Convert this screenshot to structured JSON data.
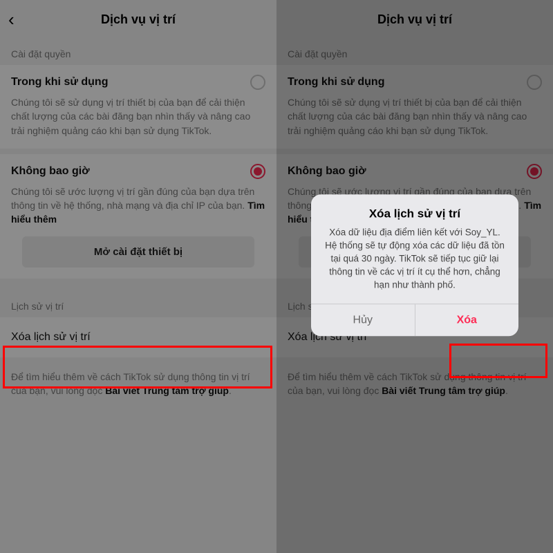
{
  "accent": "#fe2c55",
  "header": {
    "title": "Dịch vụ vị trí"
  },
  "sections": {
    "permissions_label": "Cài đặt quyền",
    "while_using": {
      "title": "Trong khi sử dụng",
      "desc": "Chúng tôi sẽ sử dụng vị trí thiết bị của bạn để cải thiện chất lượng của các bài đăng bạn nhìn thấy và nâng cao trải nghiệm quảng cáo khi bạn sử dụng TikTok."
    },
    "never": {
      "title": "Không bao giờ",
      "desc_prefix": "Chúng tôi sẽ ước lượng vị trí gần đúng của bạn dựa trên thông tin về hệ thống, nhà mạng và địa chỉ IP của bạn. ",
      "learn_more": "Tìm hiểu thêm"
    },
    "open_device_settings": "Mở cài đặt thiết bị",
    "history_label": "Lịch sử vị trí",
    "clear_history": "Xóa lịch sử vị trí",
    "footer_prefix": "Để tìm hiểu thêm về cách TikTok sử dụng thông tin vị trí của bạn, vui lòng đọc ",
    "footer_link": "Bài viết Trung tâm trợ giúp",
    "footer_suffix": "."
  },
  "dialog": {
    "title": "Xóa lịch sử vị trí",
    "body": "Xóa dữ liệu địa điểm liên kết với Soy_YL. Hệ thống sẽ tự động xóa các dữ liệu đã tồn tại quá 30 ngày. TikTok sẽ tiếp tục giữ lại thông tin về các vị trí ít cụ thể hơn, chẳng hạn như thành phố.",
    "cancel": "Hủy",
    "delete": "Xóa"
  }
}
